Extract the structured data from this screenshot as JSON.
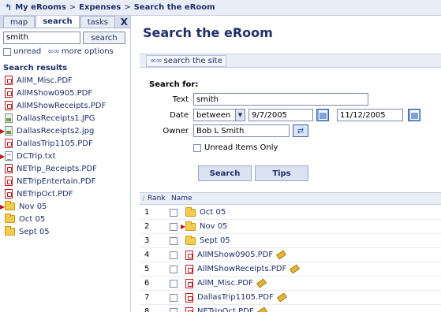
{
  "breadcrumb": {
    "items": [
      "My eRooms",
      "Expenses",
      "Search the eRoom"
    ],
    "separator": ">"
  },
  "left_panel": {
    "tabs": [
      {
        "label": "map",
        "active": false
      },
      {
        "label": "search",
        "active": true
      },
      {
        "label": "tasks",
        "active": false
      }
    ],
    "close_label": "X",
    "search_value": "smith",
    "search_button": "search",
    "unread_label": "unread",
    "more_options_label": "more options",
    "results_heading": "Search results",
    "results": [
      {
        "label": "AllM_Misc.PDF",
        "icon": "pdf-icon",
        "arrow": false
      },
      {
        "label": "AllMShow0905.PDF",
        "icon": "pdf-icon",
        "arrow": false
      },
      {
        "label": "AllMShowReceipts.PDF",
        "icon": "pdf-icon",
        "arrow": false
      },
      {
        "label": "DallasReceipts1.JPG",
        "icon": "jpg-icon",
        "arrow": false
      },
      {
        "label": "DallasReceipts2.jpg",
        "icon": "jpg-icon",
        "arrow": true
      },
      {
        "label": "DallasTrip1105.PDF",
        "icon": "pdf-icon",
        "arrow": false
      },
      {
        "label": "DCTrip.txt",
        "icon": "txt-icon",
        "arrow": true
      },
      {
        "label": "NETrip_Receipts.PDF",
        "icon": "pdf-icon",
        "arrow": false
      },
      {
        "label": "NETripEntertain.PDF",
        "icon": "pdf-icon",
        "arrow": false
      },
      {
        "label": "NETripOct.PDF",
        "icon": "pdf-icon",
        "arrow": false
      },
      {
        "label": "Nov 05",
        "icon": "folder-icon",
        "arrow": true
      },
      {
        "label": "Oct 05",
        "icon": "folder-icon",
        "arrow": false
      },
      {
        "label": "Sept 05",
        "icon": "folder-icon",
        "arrow": false
      }
    ]
  },
  "main": {
    "title": "Search the eRoom",
    "site_link": "search the site",
    "form": {
      "heading": "Search for:",
      "text_label": "Text",
      "text_value": "smith",
      "date_label": "Date",
      "date_mode": "between",
      "date_from": "9/7/2005",
      "date_to": "11/12/2005",
      "owner_label": "Owner",
      "owner_value": "Bob L Smith",
      "unread_only_label": "Unread Items Only",
      "search_button": "Search",
      "tips_button": "Tips"
    },
    "table": {
      "rank_header": "Rank",
      "name_header": "Name",
      "rows": [
        {
          "rank": "1",
          "name": "Oct 05",
          "icon": "folder-icon",
          "arrow": false,
          "edit": false
        },
        {
          "rank": "2",
          "name": "Nov 05",
          "icon": "folder-icon",
          "arrow": true,
          "edit": false
        },
        {
          "rank": "3",
          "name": "Sept 05",
          "icon": "folder-icon",
          "arrow": false,
          "edit": false
        },
        {
          "rank": "4",
          "name": "AllMShow0905.PDF",
          "icon": "pdf-icon",
          "arrow": false,
          "edit": true
        },
        {
          "rank": "5",
          "name": "AllMShowReceipts.PDF",
          "icon": "pdf-icon",
          "arrow": false,
          "edit": true
        },
        {
          "rank": "6",
          "name": "AllM_Misc.PDF",
          "icon": "pdf-icon",
          "arrow": false,
          "edit": true
        },
        {
          "rank": "7",
          "name": "DallasTrip1105.PDF",
          "icon": "pdf-icon",
          "arrow": false,
          "edit": true
        },
        {
          "rank": "8",
          "name": "NETripOct.PDF",
          "icon": "pdf-icon",
          "arrow": false,
          "edit": true
        }
      ]
    }
  }
}
